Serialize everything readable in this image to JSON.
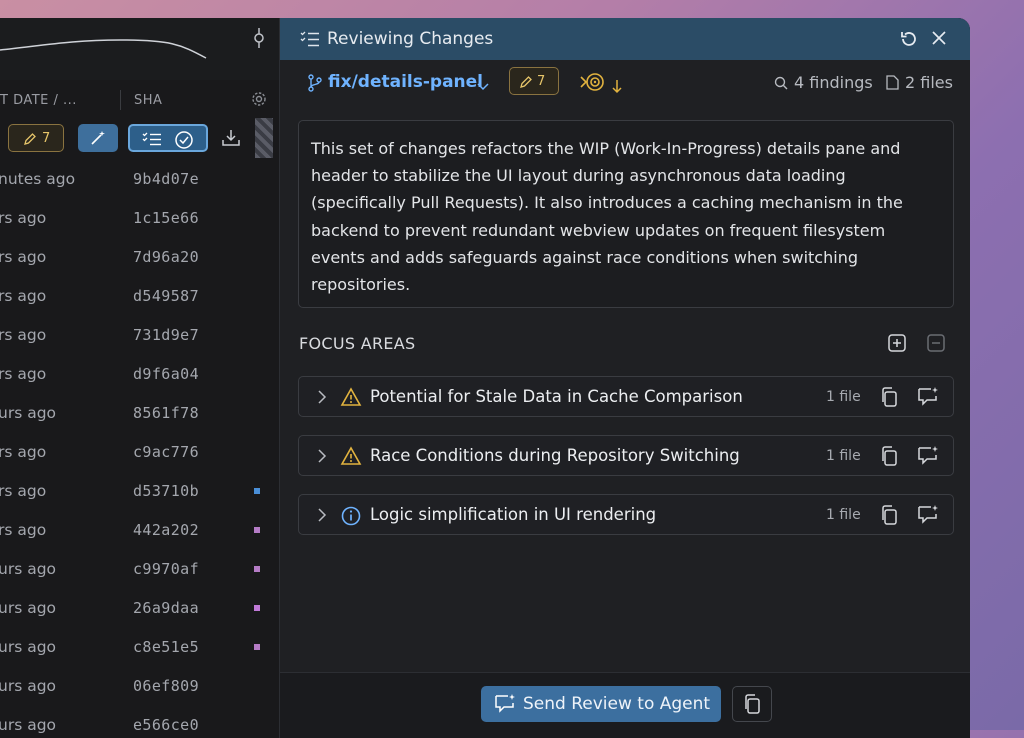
{
  "left_pane": {
    "header": {
      "date_label": "T DATE / ...",
      "sha_label": "SHA"
    },
    "toolbar": {
      "pencil_count": "7"
    },
    "rows": [
      {
        "time": "nutes ago",
        "sha": "9b4d07e",
        "dot": ""
      },
      {
        "time": "rs ago",
        "sha": "1c15e66",
        "dot": ""
      },
      {
        "time": "rs ago",
        "sha": "7d96a20",
        "dot": ""
      },
      {
        "time": "rs ago",
        "sha": "d549587",
        "dot": ""
      },
      {
        "time": "rs ago",
        "sha": "731d9e7",
        "dot": ""
      },
      {
        "time": "rs ago",
        "sha": "d9f6a04",
        "dot": ""
      },
      {
        "time": "urs ago",
        "sha": "8561f78",
        "dot": ""
      },
      {
        "time": "rs ago",
        "sha": "c9ac776",
        "dot": ""
      },
      {
        "time": "rs ago",
        "sha": "d53710b",
        "dot": "#4a8fd8"
      },
      {
        "time": "rs ago",
        "sha": "442a202",
        "dot": "#b57cc6"
      },
      {
        "time": "urs ago",
        "sha": "c9970af",
        "dot": "#b57cc6"
      },
      {
        "time": "urs ago",
        "sha": "26a9daa",
        "dot": "#c07ad8"
      },
      {
        "time": "urs ago",
        "sha": "c8e51e5",
        "dot": "#b57cc6"
      },
      {
        "time": "urs ago",
        "sha": "06ef809",
        "dot": ""
      },
      {
        "time": "urs ago",
        "sha": "e566ce0",
        "dot": ""
      }
    ]
  },
  "review": {
    "title": "Reviewing Changes",
    "branch": "fix/details-panel",
    "pencil_count": "7",
    "findings": "4 findings",
    "files": "2 files",
    "summary": "This set of changes refactors the WIP (Work-In-Progress) details pane and header to stabilize the UI layout during asynchronous data loading (specifically Pull Requests). It also introduces a caching mechanism in the backend to prevent redundant webview updates on frequent filesystem events and adds safeguards against race conditions when switching repositories.",
    "focus_title": "FOCUS AREAS",
    "focus_items": [
      {
        "label": "Potential for Stale Data in Cache Comparison",
        "count": "1 file",
        "icon": "warning-icon"
      },
      {
        "label": "Race Conditions during Repository Switching",
        "count": "1 file",
        "icon": "warning-icon"
      },
      {
        "label": "Logic simplification in UI rendering",
        "count": "1 file",
        "icon": "info-icon"
      }
    ],
    "send_label": "Send Review to Agent"
  },
  "colors": {
    "accent": "#3c6f9f",
    "titlebar": "#2b4c66",
    "branch": "#6fb3ff",
    "warning": "#e2b33f",
    "info": "#6fb3ff"
  }
}
